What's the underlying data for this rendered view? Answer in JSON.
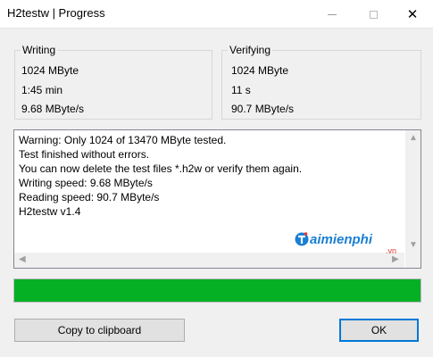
{
  "window": {
    "title": "H2testw | Progress"
  },
  "writing": {
    "label": "Writing",
    "size": "1024 MByte",
    "time": "1:45 min",
    "speed": "9.68 MByte/s"
  },
  "verifying": {
    "label": "Verifying",
    "size": "1024 MByte",
    "time": "11 s",
    "speed": "90.7 MByte/s"
  },
  "log": {
    "lines": [
      "Warning: Only 1024 of 13470 MByte tested.",
      "Test finished without errors.",
      "You can now delete the test files *.h2w or verify them again.",
      "Writing speed: 9.68 MByte/s",
      "Reading speed: 90.7 MByte/s",
      "H2testw v1.4"
    ]
  },
  "watermark": {
    "brand": "aimienphi",
    "suffix": ".vn"
  },
  "progress": {
    "value_percent": 100,
    "color": "#06b025"
  },
  "buttons": {
    "copy": "Copy to clipboard",
    "ok": "OK"
  }
}
